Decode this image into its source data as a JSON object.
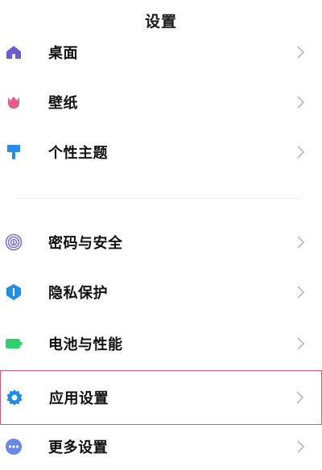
{
  "header": {
    "title": "设置"
  },
  "group1": [
    {
      "label": "桌面",
      "icon": "home-icon",
      "color": "#6b5cd6"
    },
    {
      "label": "壁纸",
      "icon": "tulip-icon",
      "color": "#e85b86"
    },
    {
      "label": "个性主题",
      "icon": "paintbrush-icon",
      "color": "#2a8ce8"
    }
  ],
  "group2": [
    {
      "label": "密码与安全",
      "icon": "fingerprint-icon",
      "color": "#7c6fe0"
    },
    {
      "label": "隐私保护",
      "icon": "shield-icon",
      "color": "#1e8fe6"
    },
    {
      "label": "电池与性能",
      "icon": "battery-icon",
      "color": "#2fcf6e"
    },
    {
      "label": "应用设置",
      "icon": "gear-icon",
      "color": "#1f8de6",
      "highlighted": true
    },
    {
      "label": "更多设置",
      "icon": "more-dots-icon",
      "color": "#6a86e8"
    }
  ],
  "colors": {
    "highlight_border": "#d65a78",
    "chevron": "#b8b8b8",
    "divider": "#eeeeee"
  }
}
